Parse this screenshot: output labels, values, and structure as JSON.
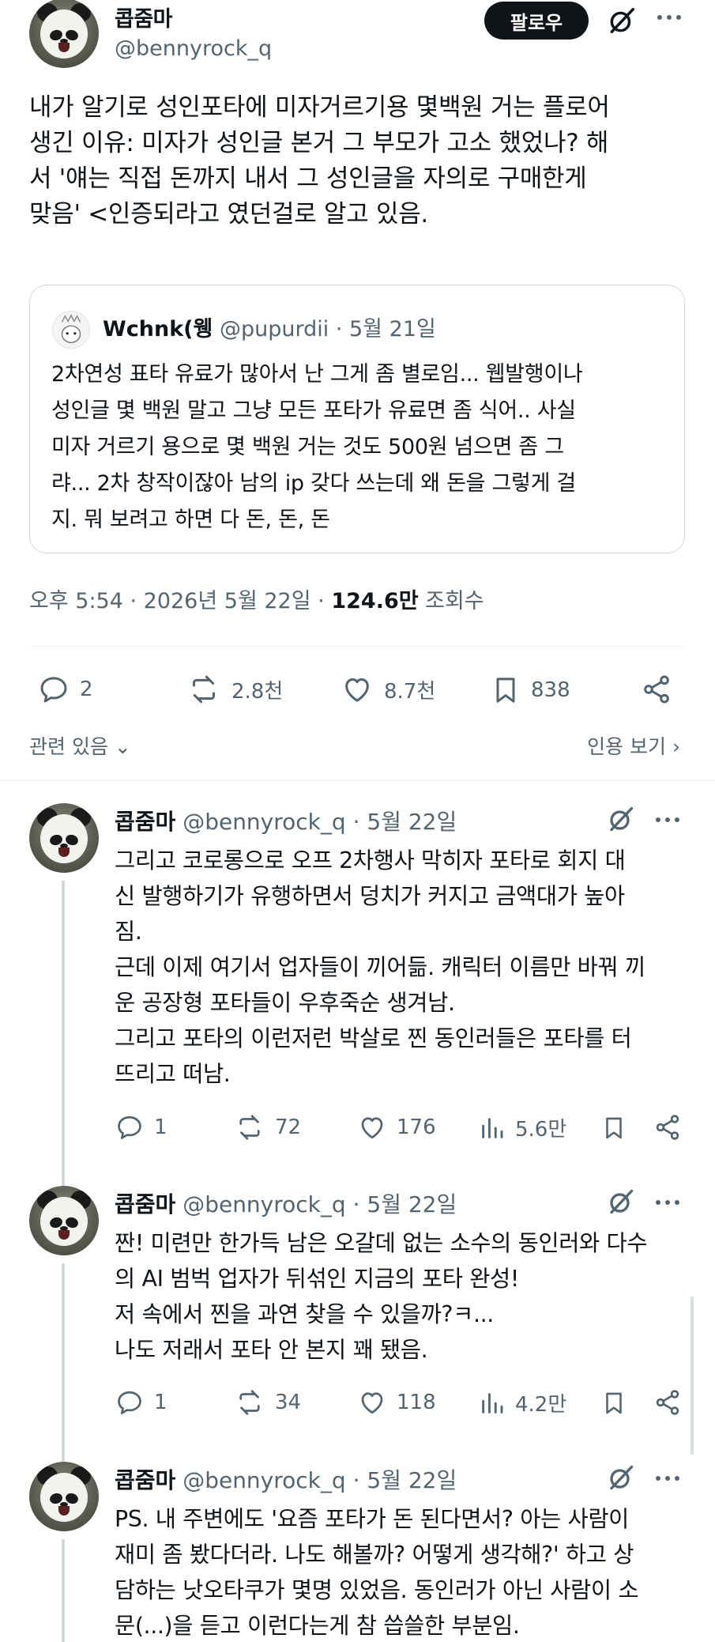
{
  "main_tweet": {
    "author_name": "콥줌마",
    "author_handle": "@bennyrock_q",
    "follow_label": "팔로우",
    "body": "내가 알기로 성인포타에 미자거르기용 몇백원 거는 플로어\n생긴 이유: 미자가 성인글 본거 그 부모가 고소 했었나? 해\n서 '얘는 직접 돈까지 내서 그 성인글을 자의로 구매한게\n맞음' <인증되라고 였던걸로 알고 있음.",
    "timestamp": "오후 5:54 · 2026년 5월 22일 · ",
    "views": "124.6만",
    "views_label": " 조회수",
    "stats": {
      "replies": "2",
      "reposts": "2.8천",
      "likes": "8.7천",
      "bookmarks": "838"
    },
    "related_label": "관련 있음",
    "quotes_label": "인용 보기"
  },
  "quoted_tweet": {
    "author_name": "Wchnk(웽",
    "author_handle": "@pupurdii",
    "date": " · 5월 21일",
    "body": "2차연성 표타 유료가 많아서 난 그게 좀 별로임... 웹발행이나\n성인글 몇 백원 말고 그냥 모든 포타가 유료면 좀 식어.. 사실\n미자 거르기 용으로 몇 백원 거는 것도 500원 넘으면 좀 그\n랴... 2차 창작이잖아 남의 ip 갖다 쓰는데 왜 돈을 그렇게 걸\n지. 뭐 보려고 하면 다 돈, 돈, 돈"
  },
  "replies": [
    {
      "author_name": "콥줌마",
      "author_handle": "@bennyrock_q",
      "date": " · 5월 22일",
      "body": "그리고 코로롱으로 오프 2차행사 막히자 포타로 회지 대\n신 발행하기가 유행하면서 덩치가 커지고 금액대가 높아\n짐.\n근데 이제 여기서 업자들이 끼어듦. 캐릭터 이름만 바꿔 끼\n운 공장형 포타들이 우후죽순 생겨남.\n그리고 포타의 이런저런 박살로 찐 동인러들은 포타를 터\n뜨리고 떠남.",
      "replies": "1",
      "reposts": "72",
      "likes": "176",
      "views": "5.6만"
    },
    {
      "author_name": "콥줌마",
      "author_handle": "@bennyrock_q",
      "date": " · 5월 22일",
      "body": "짠! 미련만 한가득 남은 오갈데 없는 소수의 동인러와 다수\n의 AI 범벅 업자가 뒤섞인 지금의 포타 완성!\n저 속에서 찐을 과연 찾을 수 있을까?ㅋ...\n나도 저래서 포타 안 본지 꽤 됐음.",
      "replies": "1",
      "reposts": "34",
      "likes": "118",
      "views": "4.2만"
    },
    {
      "author_name": "콥줌마",
      "author_handle": "@bennyrock_q",
      "date": " · 5월 22일",
      "body": "PS. 내 주변에도 '요즘 포타가 돈 된다면서? 아는 사람이\n재미 좀 봤다더라. 나도 해볼까? 어떻게 생각해?' 하고 상\n담하는 낫오타쿠가 몇명 있었음. 동인러가 아닌 사람이 소\n문(...)을 듣고 이런다는게 참 씁쓸한 부분임."
    }
  ],
  "icons": {
    "reply": "speech-bubble-icon",
    "repost": "repost-arrows-icon",
    "like": "heart-icon",
    "views": "bar-chart-icon",
    "bookmark": "bookmark-icon",
    "share": "share-icon",
    "grok": "grok-icon",
    "more": "more-dots-icon"
  },
  "colors": {
    "text": "#0f1419",
    "secondary": "#536471",
    "border": "#cfd9de"
  }
}
